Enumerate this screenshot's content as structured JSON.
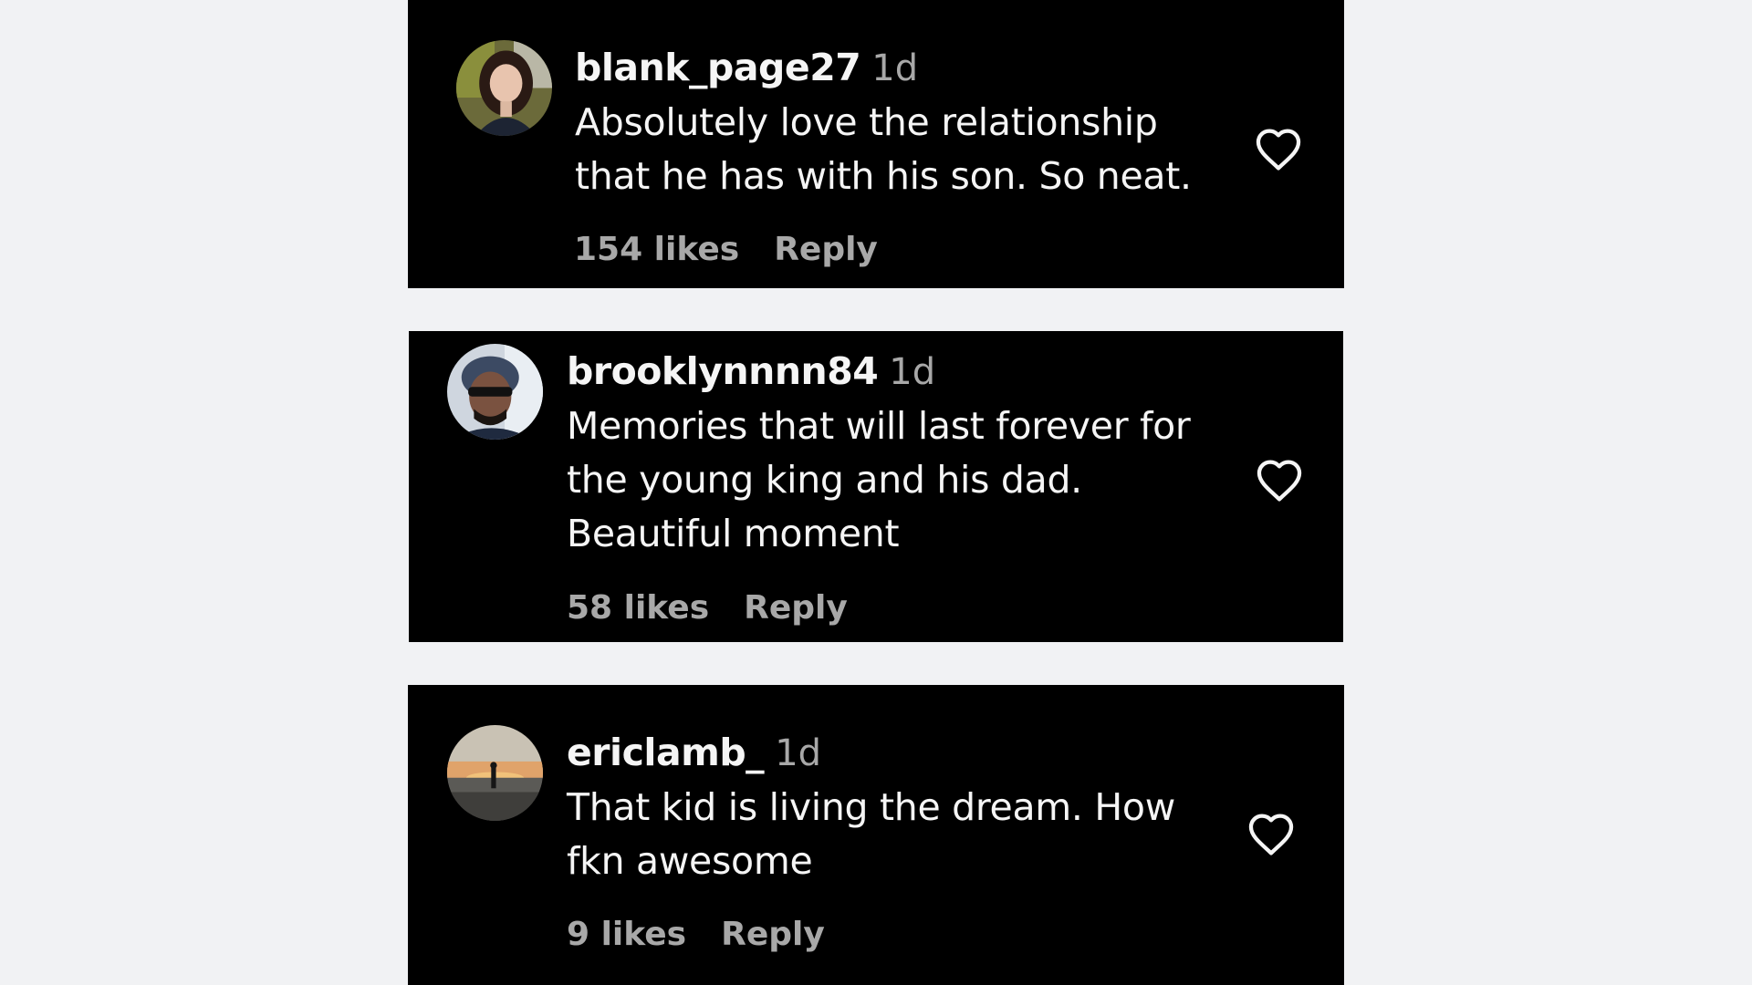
{
  "comments": [
    {
      "username": "blank_page27",
      "time": "1d",
      "lines": [
        "Absolutely love the relationship",
        "that he has with his son. So neat."
      ],
      "likes": "154 likes",
      "reply": "Reply",
      "avatar_icon": "avatar-woman-photo"
    },
    {
      "username": "brooklynnnn84",
      "time": "1d",
      "lines": [
        "Memories that will last forever for",
        "the young king and his dad.",
        "Beautiful moment"
      ],
      "likes": "58 likes",
      "reply": "Reply",
      "avatar_icon": "avatar-man-sunglasses-photo"
    },
    {
      "username": "ericlamb_",
      "time": "1d",
      "lines": [
        "That kid is living the dream. How",
        "fkn awesome"
      ],
      "likes": "9 likes",
      "reply": "Reply",
      "avatar_icon": "avatar-sunset-beach-photo"
    }
  ],
  "colors": {
    "page_background": "#f1f2f4",
    "card_background": "#000000",
    "primary_text": "#f5f5f5",
    "secondary_text": "#a8a8a8"
  },
  "icons": {
    "like": "heart-outline-icon"
  }
}
